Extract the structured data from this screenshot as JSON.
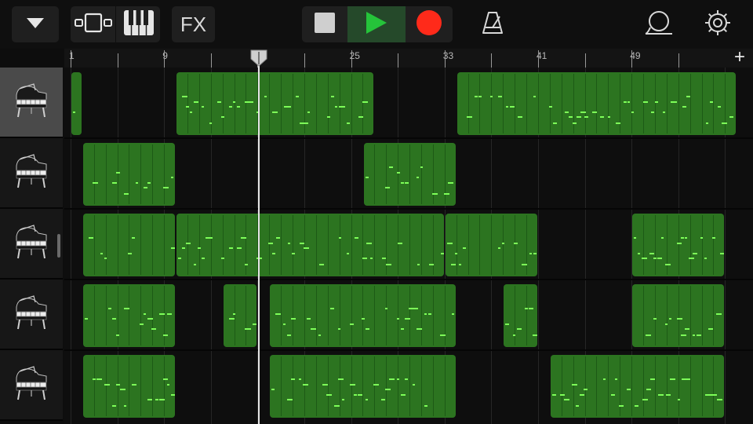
{
  "toolbar": {
    "menu_icon": "triangle-down-icon",
    "tracks_view_icon": "tracks-view-icon",
    "keyboard_icon": "piano-keys-icon",
    "fx_label": "FX",
    "stop_icon": "stop-icon",
    "play_icon": "play-icon",
    "record_icon": "record-icon",
    "metronome_icon": "metronome-icon",
    "loop_icon": "loop-browser-icon",
    "settings_icon": "gear-icon",
    "colors": {
      "play": "#25c43a",
      "record": "#ff2a1a",
      "play_bg": "#25492a"
    }
  },
  "ruler": {
    "labels": [
      "1",
      "9",
      "17",
      "25",
      "33",
      "41",
      "49"
    ],
    "add_label": "+"
  },
  "tracks": [
    {
      "instrument_icon": "grand-piano-icon",
      "selected": true
    },
    {
      "instrument_icon": "grand-piano-icon",
      "selected": false
    },
    {
      "instrument_icon": "grand-piano-icon",
      "selected": false
    },
    {
      "instrument_icon": "grand-piano-icon",
      "selected": false
    },
    {
      "instrument_icon": "grand-piano-icon",
      "selected": false
    }
  ],
  "regions": [
    [
      [
        1,
        2
      ],
      [
        10,
        27
      ],
      [
        34,
        58
      ]
    ],
    [
      [
        2,
        10
      ],
      [
        26,
        34
      ]
    ],
    [
      [
        2,
        10
      ],
      [
        10,
        33
      ],
      [
        33,
        41
      ],
      [
        49,
        57
      ]
    ],
    [
      [
        2,
        10
      ],
      [
        14,
        17
      ],
      [
        18,
        34
      ],
      [
        38,
        41
      ],
      [
        49,
        57
      ]
    ],
    [
      [
        2,
        10
      ],
      [
        18,
        34
      ],
      [
        42,
        57
      ]
    ]
  ],
  "playhead_bar": 17.1,
  "colors": {
    "region": "#2c7420",
    "note": "#7dff58"
  }
}
